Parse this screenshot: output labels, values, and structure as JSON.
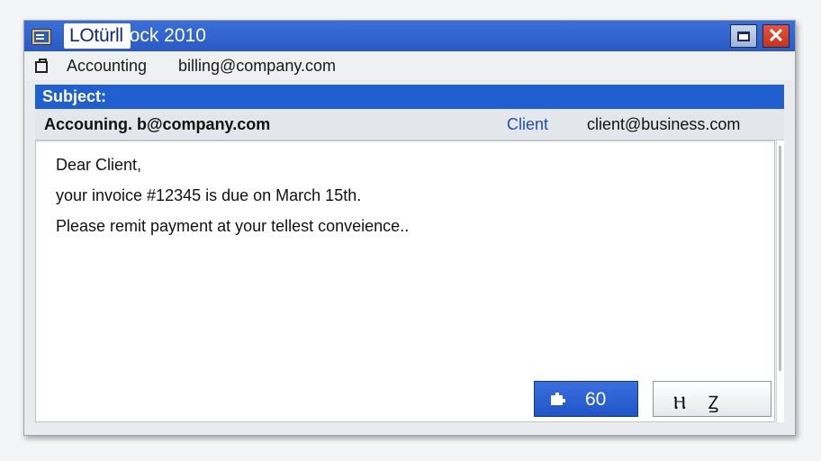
{
  "window": {
    "title_prefix": "LOtürll",
    "title_suffix": "lock 2010",
    "app_icon": "mail-app-icon",
    "controls": {
      "maximize_icon": "maximize-icon",
      "close_icon": "close-icon",
      "close_glyph": "✕"
    }
  },
  "toolbar": {
    "icon": "folder-icon",
    "sender_name": "Accounting",
    "sender_email": "billing@company.com"
  },
  "subject": {
    "label": "Subject:"
  },
  "header": {
    "from_text": "Accouning.  b@company.com",
    "to_label": "Client",
    "to_email": "client@business.com"
  },
  "body": {
    "lines": [
      "Dear Client,",
      "your invoice #12345 is due on March 15th.",
      "Please remit payment at your tellest conveience.."
    ]
  },
  "actions": {
    "send_label": "60",
    "send_icon": "puzzle-icon",
    "other_label": "Ⲏ   Ꙁ"
  },
  "colors": {
    "title_bar": "#2a5ac4",
    "subject_bar": "#1f5fd0",
    "client_label": "#1f4fb4",
    "close_button": "#c4321c"
  }
}
